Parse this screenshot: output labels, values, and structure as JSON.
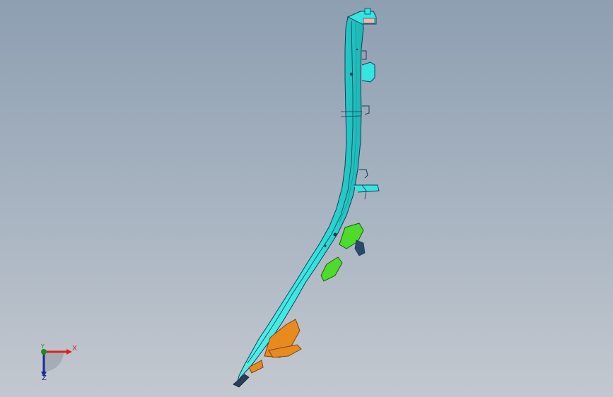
{
  "viewport": {
    "background_top": "#8e9fb2",
    "background_bottom": "#c3c8cf"
  },
  "model": {
    "icon": "automotive-a-pillar-part",
    "colors": {
      "main_panel": "#33e6e0",
      "panel_shadow": "#1bb7b4",
      "reinforcement": "#4ddc2a",
      "bracket_lower": "#e88a1e",
      "tip_cap": "#f0b7b0",
      "edge": "#1a3a5a"
    }
  },
  "triad": {
    "x_label": "X",
    "y_label": "Y",
    "z_label": "Z",
    "x_color": "#e02020",
    "y_color": "#1e8a1e",
    "z_color": "#1a2a9a"
  }
}
